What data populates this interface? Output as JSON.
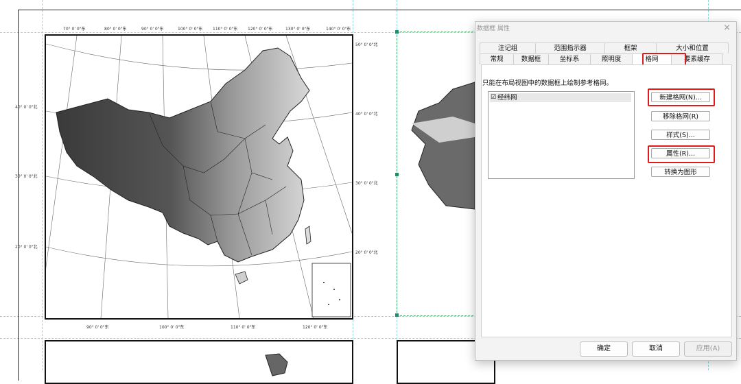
{
  "map": {
    "lon_top": [
      "70° 0' 0\"东",
      "80° 0' 0\"东",
      "90° 0' 0\"东",
      "100° 0' 0\"东",
      "110° 0' 0\"东",
      "120° 0' 0\"东",
      "130° 0' 0\"东",
      "140° 0' 0\"东"
    ],
    "lon_bottom": [
      "90° 0' 0\"东",
      "100° 0' 0\"东",
      "110° 0' 0\"东",
      "120° 0' 0\"东"
    ],
    "lat_right": [
      "50° 0' 0\"北",
      "40° 0' 0\"北",
      "30° 0' 0\"北",
      "20° 0' 0\"北"
    ],
    "lat_left": [
      "40° 0' 0\"北",
      "30° 0' 0\"北",
      "20° 0' 0\"北"
    ]
  },
  "dialog": {
    "title": "数据框 属性",
    "close": "×",
    "tabs_row1": [
      "注记组",
      "范围指示器",
      "框架",
      "大小和位置"
    ],
    "tabs_row2": [
      "常规",
      "数据框",
      "坐标系",
      "照明度",
      "格网",
      "要素缓存"
    ],
    "description": "只能在布局视图中的数据框上绘制参考格网。",
    "list_items": [
      {
        "checked": "☑",
        "label": "经纬网"
      }
    ],
    "buttons": {
      "new_grid": "新建格网(N)...",
      "remove_grid": "移除格网(R)",
      "style": "样式(S)...",
      "properties": "属性(R)...",
      "convert": "转换为图形"
    },
    "footer": {
      "ok": "确定",
      "cancel": "取消",
      "apply": "应用(A)"
    }
  },
  "colors": {
    "highlight": "#e01a1a",
    "guide": "#8fd8e0"
  }
}
